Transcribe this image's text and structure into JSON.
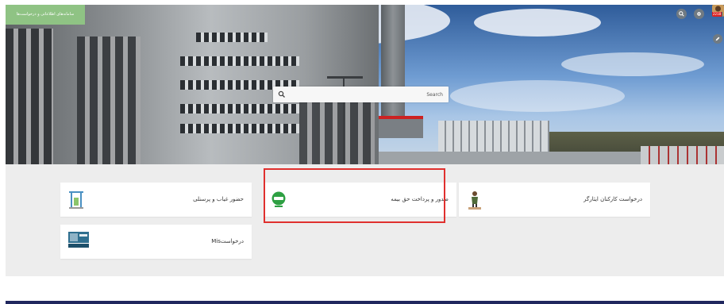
{
  "header": {
    "menu_label": "سامانه‌های اطلاعاتی و درخواست‌ها",
    "avatar_badge": "2218"
  },
  "search": {
    "placeholder": "Search"
  },
  "cards": [
    {
      "label": "درخواست کارکنان ایثارگر",
      "icon": "veteran-icon"
    },
    {
      "label": "صدور و پرداخت حق بیمه",
      "icon": "insurance-icon"
    },
    {
      "label": "حضور غیاب و پرسنلی",
      "icon": "attendance-icon"
    },
    {
      "label": "درخواستMis",
      "icon": "mis-icon"
    }
  ],
  "colors": {
    "menu_green": "#8fc384",
    "highlight_red": "#e0302e",
    "footer_navy": "#20275e",
    "panel_gray": "#ededed"
  }
}
